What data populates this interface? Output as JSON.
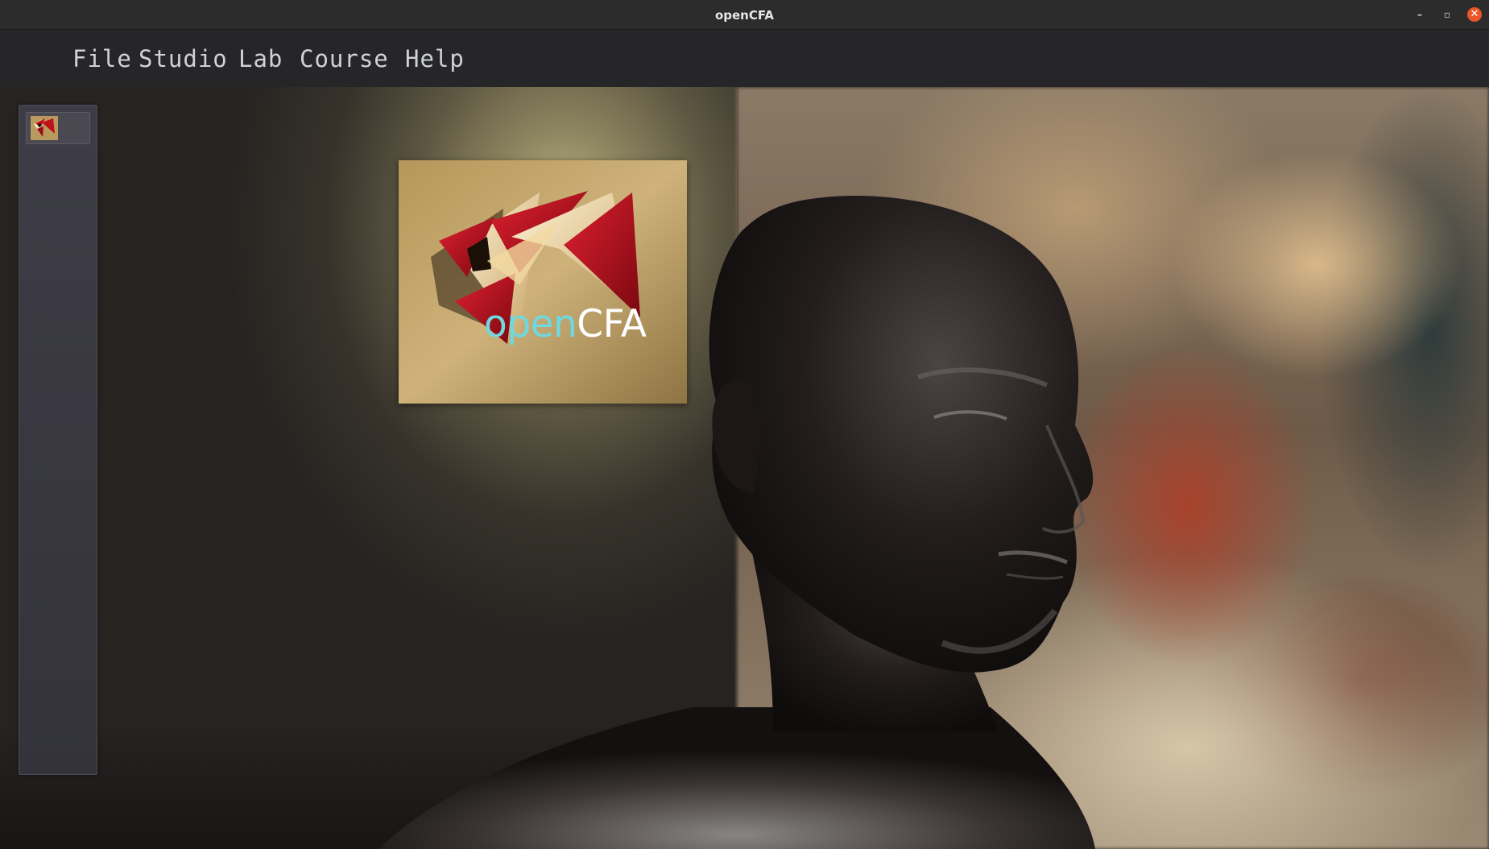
{
  "window": {
    "title": "openCFA",
    "controls": {
      "minimize": "–",
      "maximize": "▫",
      "close": "✕"
    }
  },
  "menu": {
    "items": [
      {
        "label": "File"
      },
      {
        "label": "Studio"
      },
      {
        "label": "Lab"
      },
      {
        "label": "Course"
      },
      {
        "label": "Help"
      }
    ]
  },
  "sidebar": {
    "tiles": [
      {
        "icon": "opencfa-logo-icon"
      }
    ]
  },
  "logo": {
    "open": "open",
    "cfa": "CFA"
  },
  "colors": {
    "menubar": "#262629",
    "titlebar": "#2c2c2c",
    "logo_open": "#6fd8e0",
    "logo_red": "#b0101c",
    "logo_gold": "#c9a865",
    "close_button": "#e8562a"
  },
  "scene": {
    "background": "blurred photo of art studio",
    "subject": "3d-rendered bust of a head"
  }
}
